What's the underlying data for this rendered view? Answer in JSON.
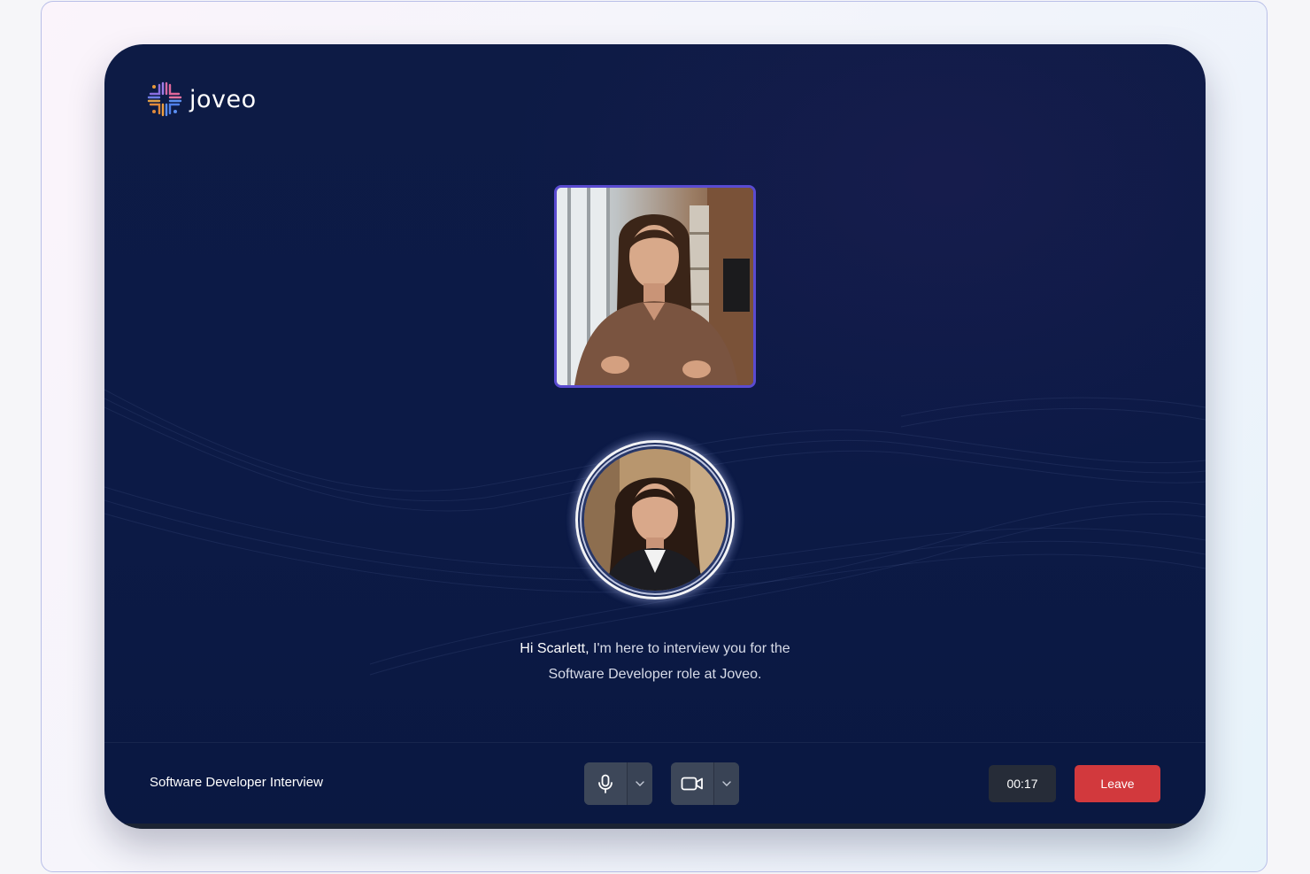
{
  "brand": {
    "name": "joveo",
    "logo_icon": "joveo-logo-icon"
  },
  "candidate_video": {
    "icon": "candidate-video-feed"
  },
  "interviewer": {
    "icon": "interviewer-avatar"
  },
  "caption": {
    "greeting_name": "Hi Scarlett,",
    "line1_rest": " I'm here to interview you for the",
    "line2": "Software Developer role at Joveo."
  },
  "bottom_bar": {
    "meeting_title": "Software Developer Interview",
    "timer": "00:17",
    "leave_label": "Leave",
    "mic_icon": "microphone-icon",
    "camera_icon": "video-camera-icon",
    "dropdown_icon": "chevron-down-icon"
  },
  "colors": {
    "background": "#0c1a46",
    "accent_border": "#5a4bd1",
    "leave": "#d2393d",
    "control": "#3d4759"
  }
}
